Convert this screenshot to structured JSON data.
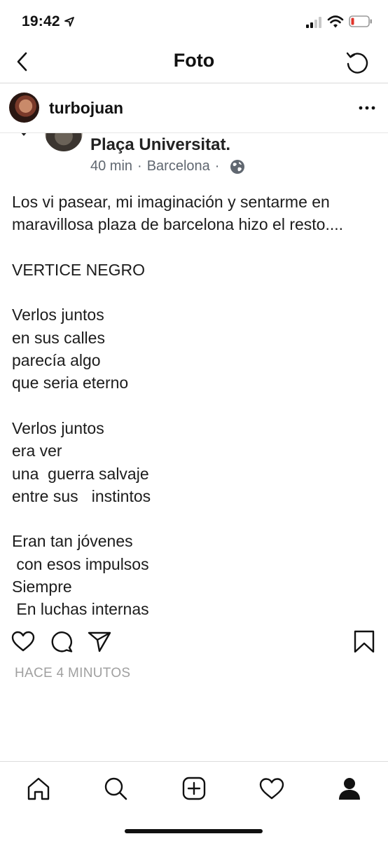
{
  "status_bar": {
    "time": "19:42",
    "icons": [
      "location-arrow-icon",
      "signal-icon",
      "wifi-icon",
      "battery-low-icon"
    ],
    "battery_color": "#e0342b"
  },
  "nav": {
    "title": "Foto",
    "back_icon": "chevron-left-icon",
    "refresh_icon": "refresh-icon"
  },
  "post": {
    "username": "turbojuan",
    "more_icon": "more-horizontal-icon",
    "photo": {
      "place_name": "Plaça Universitat.",
      "time_ago": "40 min",
      "separator": "·",
      "city": "Barcelona",
      "privacy_icon": "globe-icon",
      "text": "Los vi pasear, mi imaginación y sentarme en\nmaravillosa plaza de barcelona hizo el resto....\n\nVERTICE NEGRO\n\nVerlos juntos\nen sus calles\nparecía algo\nque seria eterno\n\nVerlos juntos\nera ver\nuna  guerra salvaje\nentre sus   instintos\n\nEran tan jóvenes\n con esos impulsos\nSiempre\n En luchas internas"
    },
    "actions": [
      "heart-icon",
      "comment-icon",
      "share-icon",
      "bookmark-icon"
    ],
    "timestamp": "HACE 4 MINUTOS"
  },
  "tab_bar": {
    "tabs": [
      "home-icon",
      "search-icon",
      "new-post-icon",
      "activity-icon",
      "profile-icon"
    ]
  }
}
